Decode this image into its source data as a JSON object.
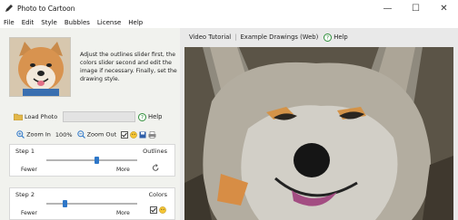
{
  "window": {
    "title": "Photo to Cartoon",
    "minimize": "—",
    "maximize": "☐",
    "close": "✕"
  },
  "menu": [
    "File",
    "Edit",
    "Style",
    "Bubbles",
    "License",
    "Help"
  ],
  "instructions": "Adjust the outlines slider first, the colors slider second and edit the image if necessary. Finally, set the drawing style.",
  "load_photo_label": "Load Photo",
  "help_label": "Help",
  "zoom": {
    "zoom_in": "Zoom In",
    "level": "100%",
    "zoom_out": "Zoom Out"
  },
  "steps": [
    {
      "title": "Step 1",
      "kind": "Outlines",
      "fewer": "Fewer",
      "more": "More",
      "value": 0.55
    },
    {
      "title": "Step 2",
      "kind": "Colors",
      "fewer": "Fewer",
      "more": "More",
      "value": 0.2
    }
  ],
  "tabs": [
    "Video Tutorial",
    "Example Drawings (Web)",
    "Help"
  ],
  "colors": {
    "accent": "#2e77c8",
    "panel": "#f1f2ee",
    "help": "#2f8f3a"
  }
}
